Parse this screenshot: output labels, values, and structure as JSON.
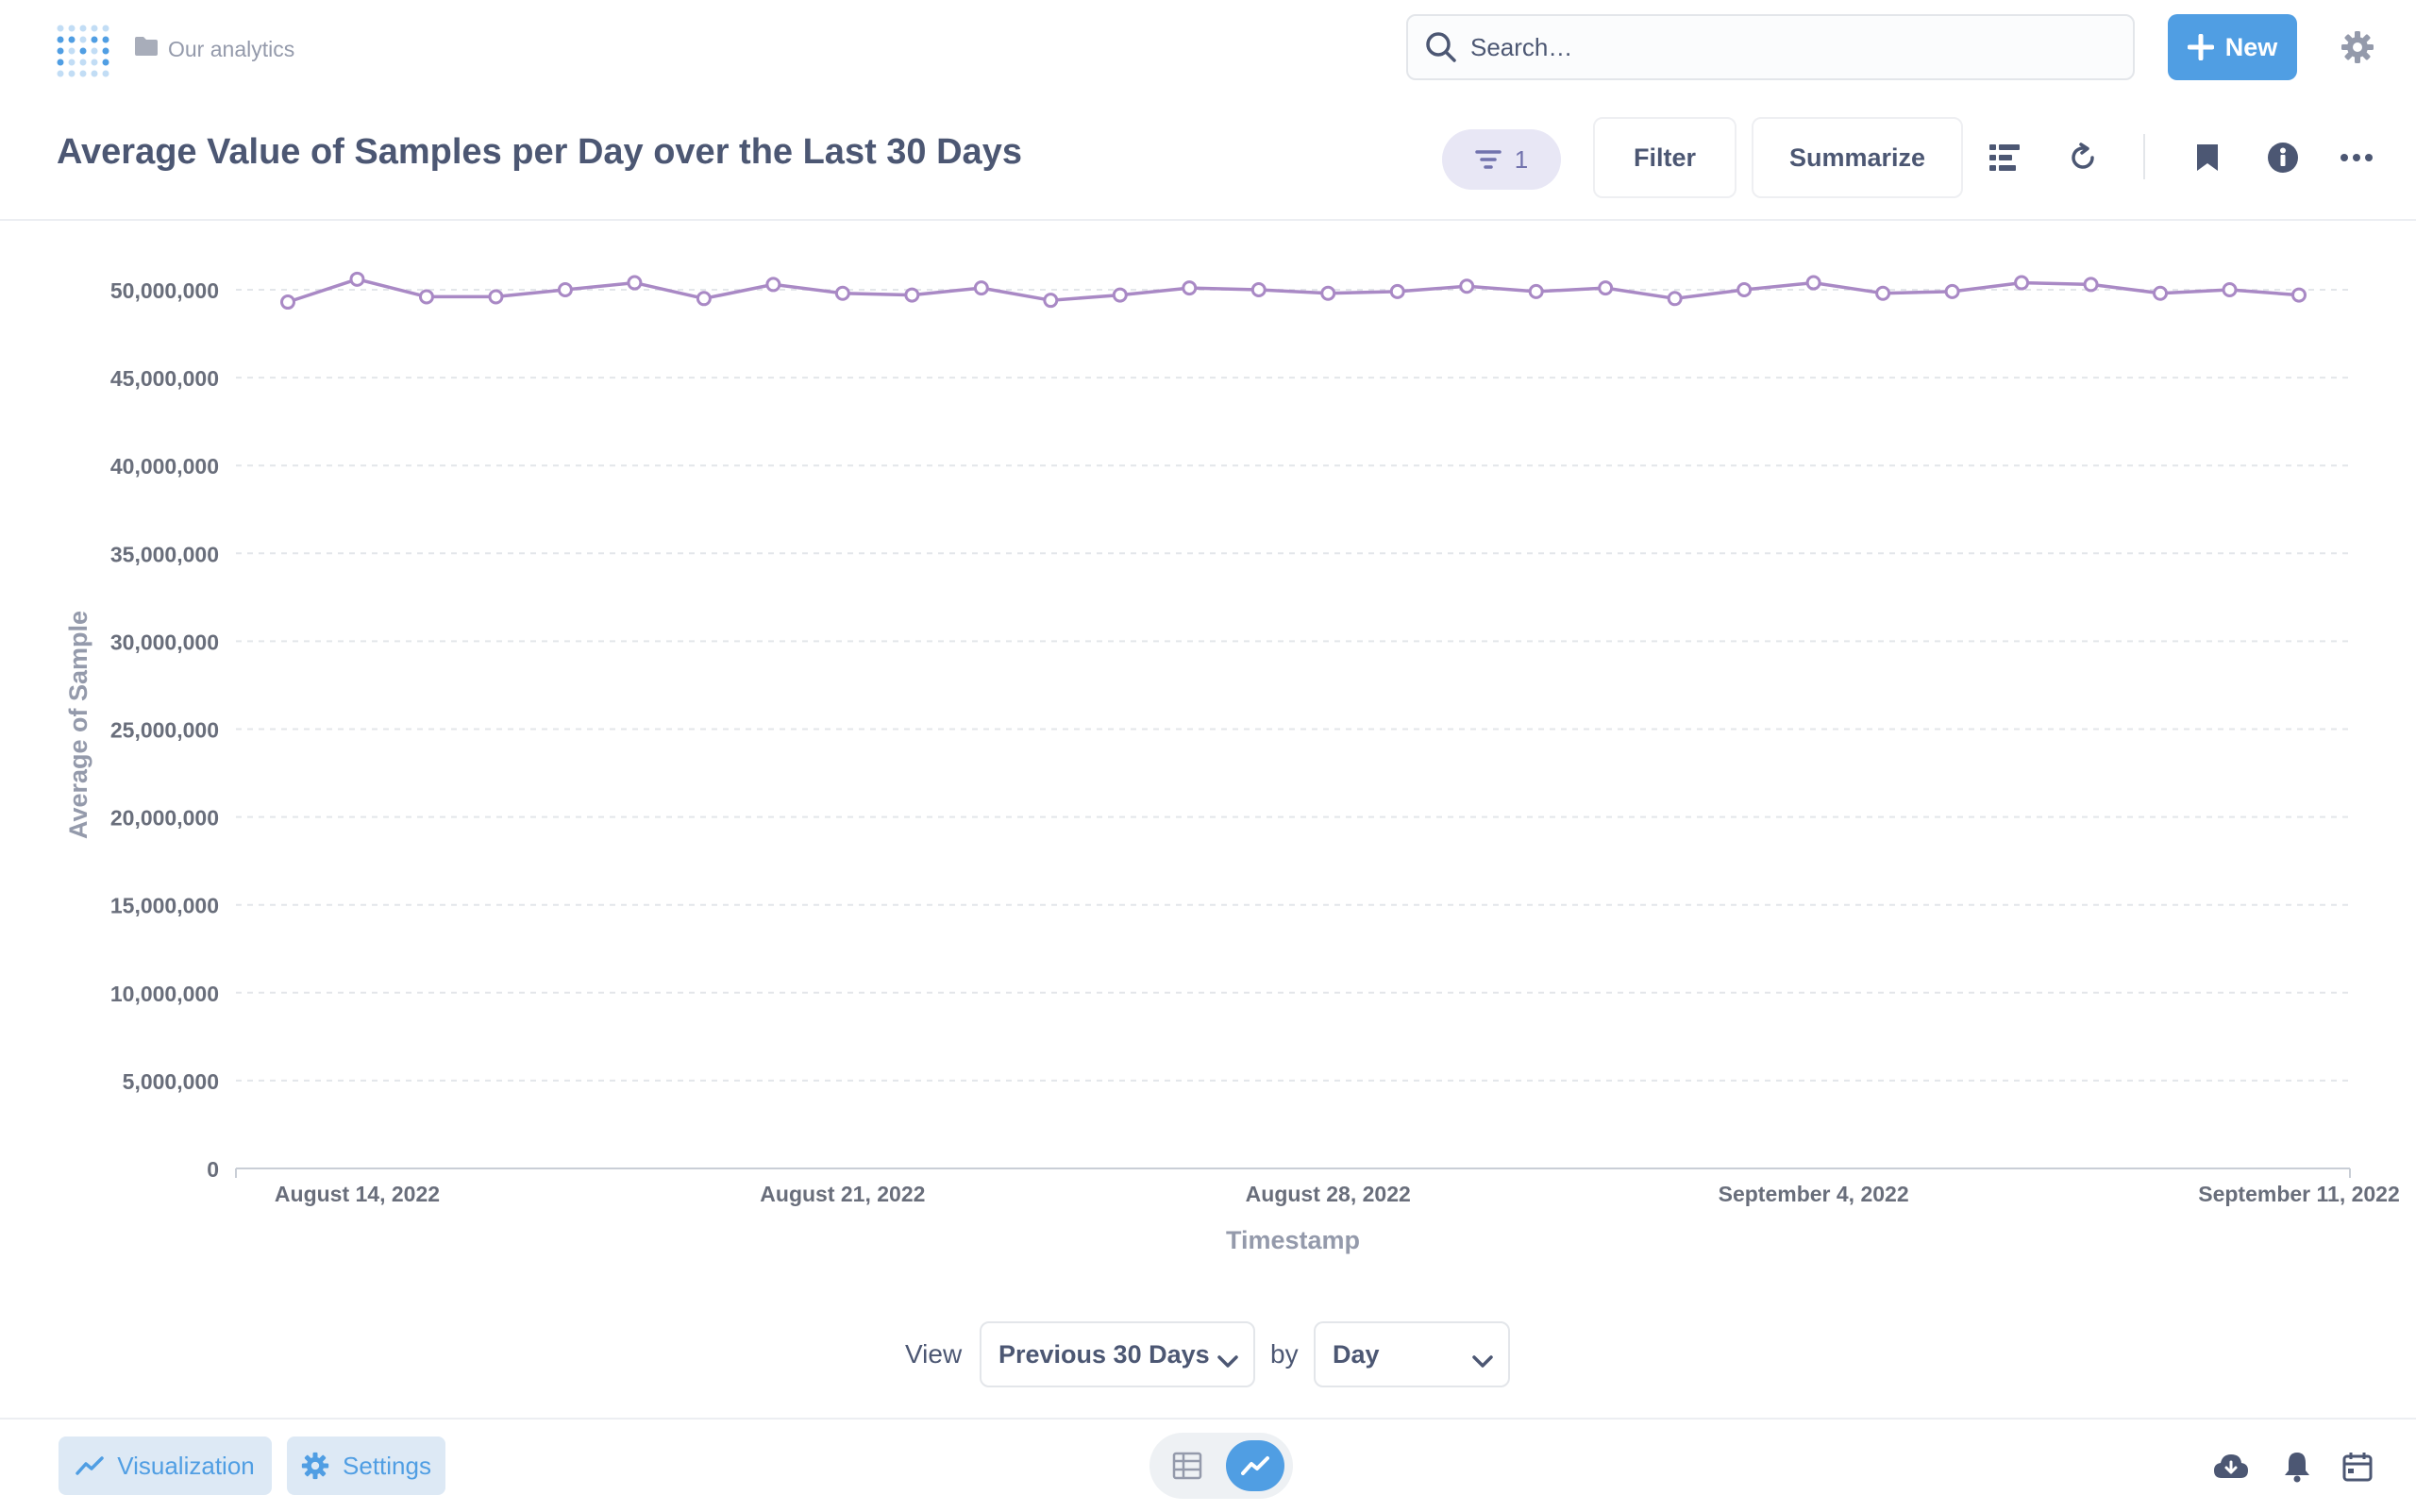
{
  "nav": {
    "breadcrumb": "Our analytics",
    "search_placeholder": "Search…",
    "new_label": "New"
  },
  "header": {
    "title": "Average Value of Samples per Day over the Last 30 Days",
    "filter_count": "1",
    "filter_label": "Filter",
    "summarize_label": "Summarize"
  },
  "chart_data": {
    "type": "line",
    "title": "",
    "xlabel": "Timestamp",
    "ylabel": "Average of Sample",
    "ylim": [
      0,
      50000000
    ],
    "yticks": [
      "0",
      "5,000,000",
      "10,000,000",
      "15,000,000",
      "20,000,000",
      "25,000,000",
      "30,000,000",
      "35,000,000",
      "40,000,000",
      "45,000,000",
      "50,000,000"
    ],
    "xticks": [
      {
        "label": "August 14, 2022",
        "index": 1
      },
      {
        "label": "August 21, 2022",
        "index": 8
      },
      {
        "label": "August 28, 2022",
        "index": 15
      },
      {
        "label": "September 4, 2022",
        "index": 22
      },
      {
        "label": "September 11, 2022",
        "index": 29
      }
    ],
    "x": [
      "2022-08-13",
      "2022-08-14",
      "2022-08-15",
      "2022-08-16",
      "2022-08-17",
      "2022-08-18",
      "2022-08-19",
      "2022-08-20",
      "2022-08-21",
      "2022-08-22",
      "2022-08-23",
      "2022-08-24",
      "2022-08-25",
      "2022-08-26",
      "2022-08-27",
      "2022-08-28",
      "2022-08-29",
      "2022-08-30",
      "2022-08-31",
      "2022-09-01",
      "2022-09-02",
      "2022-09-03",
      "2022-09-04",
      "2022-09-05",
      "2022-09-06",
      "2022-09-07",
      "2022-09-08",
      "2022-09-09",
      "2022-09-10",
      "2022-09-11"
    ],
    "series": [
      {
        "color": "#a989c5",
        "values": [
          49300000,
          50600000,
          49600000,
          49600000,
          50000000,
          50400000,
          49500000,
          50300000,
          49800000,
          49700000,
          50100000,
          49400000,
          49700000,
          50100000,
          50000000,
          49800000,
          49900000,
          50200000,
          49900000,
          50100000,
          49500000,
          50000000,
          50400000,
          49800000,
          49900000,
          50400000,
          50300000,
          49800000,
          50000000,
          49700000
        ]
      }
    ],
    "grid": true,
    "legend": "none"
  },
  "view": {
    "view_label": "View",
    "period": "Previous 30 Days",
    "by_label": "by",
    "granularity": "Day"
  },
  "footer": {
    "visualization_label": "Visualization",
    "settings_label": "Settings"
  },
  "colors": {
    "brand": "#509ee3",
    "series": "#a989c5",
    "text": "#4c5773"
  }
}
